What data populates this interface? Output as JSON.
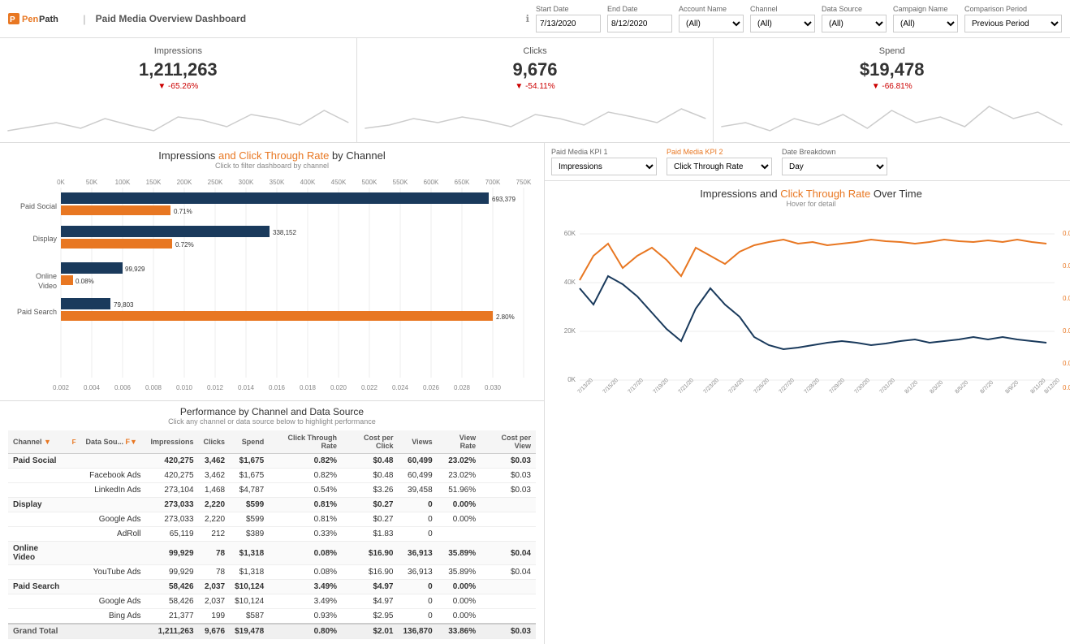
{
  "header": {
    "logo_text": "PenPath",
    "logo_pen": "Pen",
    "logo_path": "Path",
    "title": "Paid Media Overview Dashboard",
    "info_icon": "ℹ",
    "filters": {
      "start_date": {
        "label": "Start Date",
        "value": "7/13/2020"
      },
      "end_date": {
        "label": "End Date",
        "value": "8/12/2020"
      },
      "account_name": {
        "label": "Account Name",
        "value": "(All)"
      },
      "channel": {
        "label": "Channel",
        "value": "(All)"
      },
      "data_source": {
        "label": "Data Source",
        "value": "(All)"
      },
      "campaign_name": {
        "label": "Campaign Name",
        "value": "(All)"
      },
      "comparison_period": {
        "label": "Comparison Period",
        "value": "Previous Period"
      }
    }
  },
  "kpis": [
    {
      "title": "Impressions",
      "value": "1,211,263",
      "change": "-65.26%",
      "change_color": "#cc0000"
    },
    {
      "title": "Clicks",
      "value": "9,676",
      "change": "-54.11%",
      "change_color": "#cc0000"
    },
    {
      "title": "Spend",
      "value": "$19,478",
      "change": "-66.81%",
      "change_color": "#cc0000"
    }
  ],
  "bar_chart": {
    "title_part1": "Impressions",
    "title_and": " and ",
    "title_part2": "Click Through Rate",
    "title_part3": " by Channel",
    "subtitle": "Click to filter dashboard by channel",
    "channels": [
      {
        "name": "Paid Social",
        "impressions": 693379,
        "ctr": 0.71
      },
      {
        "name": "Display",
        "impressions": 338152,
        "ctr": 0.72
      },
      {
        "name": "Online Video",
        "impressions": 99929,
        "ctr": 0.08
      },
      {
        "name": "Paid Search",
        "impressions": 79803,
        "ctr": 2.8
      }
    ]
  },
  "kpi_selectors": {
    "kpi1_label": "Paid Media KPI 1",
    "kpi1_value": "Impressions",
    "kpi2_label": "Paid Media KPI 2",
    "kpi2_value": "Click Through Rate",
    "date_breakdown_label": "Date Breakdown",
    "date_breakdown_value": "Day"
  },
  "line_chart": {
    "title_part1": "Impressions",
    "title_and": " and ",
    "title_part2": "Click Through Rate",
    "title_part3": " Over Time",
    "subtitle": "Hover for detail"
  },
  "table": {
    "title": "Performance by Channel and Data Source",
    "subtitle": "Click any channel or data source below to highlight performance",
    "columns": [
      "Channel",
      "F▼",
      "Data Sou... F▼",
      "Impressions",
      "Clicks",
      "Spend",
      "Click Through Rate",
      "Cost per Click",
      "Views",
      "View Rate",
      "Cost per View"
    ],
    "rows": [
      {
        "type": "channel",
        "channel": "Paid Social",
        "datasource": "",
        "impressions": "420,275",
        "clicks": "3,462",
        "spend": "$1,675",
        "ctr": "0.82%",
        "cpc": "$0.48",
        "views": "60,499",
        "view_rate": "23.02%",
        "cpv": "$0.03"
      },
      {
        "type": "datasource",
        "channel": "",
        "datasource": "Facebook Ads",
        "impressions": "420,275",
        "clicks": "3,462",
        "spend": "$1,675",
        "ctr": "0.82%",
        "cpc": "$0.48",
        "views": "60,499",
        "view_rate": "23.02%",
        "cpv": "$0.03"
      },
      {
        "type": "datasource",
        "channel": "",
        "datasource": "LinkedIn Ads",
        "impressions": "273,104",
        "clicks": "1,468",
        "spend": "$4,787",
        "ctr": "0.54%",
        "cpc": "$3.26",
        "views": "39,458",
        "view_rate": "51.96%",
        "cpv": "$0.03"
      },
      {
        "type": "channel",
        "channel": "Display",
        "datasource": "",
        "impressions": "273,033",
        "clicks": "2,220",
        "spend": "$599",
        "ctr": "0.81%",
        "cpc": "$0.27",
        "views": "0",
        "view_rate": "0.00%",
        "cpv": ""
      },
      {
        "type": "datasource",
        "channel": "",
        "datasource": "Google Ads",
        "impressions": "273,033",
        "clicks": "2,220",
        "spend": "$599",
        "ctr": "0.81%",
        "cpc": "$0.27",
        "views": "0",
        "view_rate": "0.00%",
        "cpv": ""
      },
      {
        "type": "datasource",
        "channel": "",
        "datasource": "AdRoll",
        "impressions": "65,119",
        "clicks": "212",
        "spend": "$389",
        "ctr": "0.33%",
        "cpc": "$1.83",
        "views": "0",
        "view_rate": "",
        "cpv": ""
      },
      {
        "type": "channel",
        "channel": "Online Video",
        "datasource": "",
        "impressions": "99,929",
        "clicks": "78",
        "spend": "$1,318",
        "ctr": "0.08%",
        "cpc": "$16.90",
        "views": "36,913",
        "view_rate": "35.89%",
        "cpv": "$0.04"
      },
      {
        "type": "datasource",
        "channel": "",
        "datasource": "YouTube Ads",
        "impressions": "99,929",
        "clicks": "78",
        "spend": "$1,318",
        "ctr": "0.08%",
        "cpc": "$16.90",
        "views": "36,913",
        "view_rate": "35.89%",
        "cpv": "$0.04"
      },
      {
        "type": "channel",
        "channel": "Paid Search",
        "datasource": "",
        "impressions": "58,426",
        "clicks": "2,037",
        "spend": "$10,124",
        "ctr": "3.49%",
        "cpc": "$4.97",
        "views": "0",
        "view_rate": "0.00%",
        "cpv": ""
      },
      {
        "type": "datasource",
        "channel": "",
        "datasource": "Google Ads",
        "impressions": "58,426",
        "clicks": "2,037",
        "spend": "$10,124",
        "ctr": "3.49%",
        "cpc": "$4.97",
        "views": "0",
        "view_rate": "0.00%",
        "cpv": ""
      },
      {
        "type": "datasource",
        "channel": "",
        "datasource": "Bing Ads",
        "impressions": "21,377",
        "clicks": "199",
        "spend": "$587",
        "ctr": "0.93%",
        "cpc": "$2.95",
        "views": "0",
        "view_rate": "0.00%",
        "cpv": ""
      },
      {
        "type": "grand_total",
        "channel": "Grand Total",
        "datasource": "",
        "impressions": "1,211,263",
        "clicks": "9,676",
        "spend": "$19,478",
        "ctr": "0.80%",
        "cpc": "$2.01",
        "views": "136,870",
        "view_rate": "33.86%",
        "cpv": "$0.03"
      }
    ]
  }
}
